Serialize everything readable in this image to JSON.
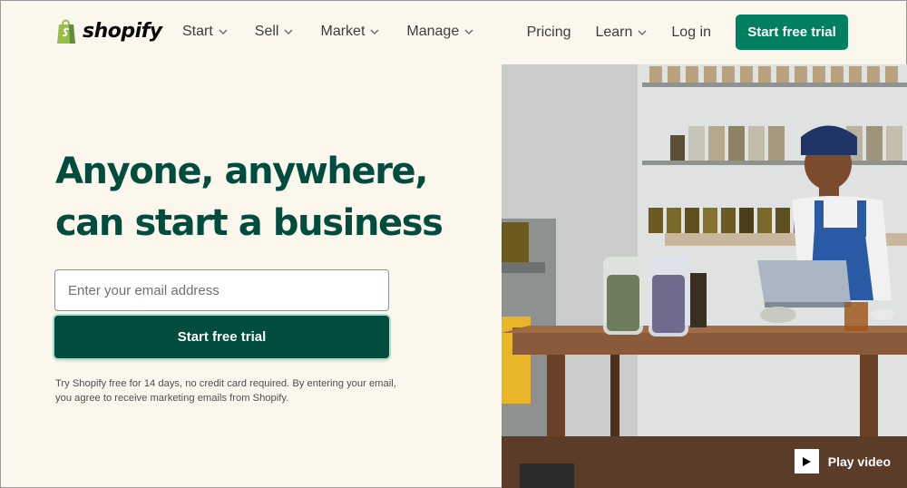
{
  "brand": {
    "name": "shopify",
    "color": "#95bf47",
    "accent": "#008060",
    "dark": "#004c3f"
  },
  "nav": {
    "items": [
      {
        "label": "Start",
        "icon": "chevron-down-icon"
      },
      {
        "label": "Sell",
        "icon": "chevron-down-icon"
      },
      {
        "label": "Market",
        "icon": "chevron-down-icon"
      },
      {
        "label": "Manage",
        "icon": "chevron-down-icon"
      }
    ],
    "pricing": "Pricing",
    "learn": "Learn",
    "login": "Log in",
    "cta": "Start free trial"
  },
  "hero": {
    "title_line1": "Anyone, anywhere,",
    "title_line2": "can start a business",
    "email_placeholder": "Enter your email address",
    "cta": "Start free trial",
    "disclaimer": "Try Shopify free for 14 days, no credit card required. By entering your email, you agree to receive marketing emails from Shopify."
  },
  "media": {
    "play_label": "Play video",
    "play_icon": "play-icon"
  }
}
